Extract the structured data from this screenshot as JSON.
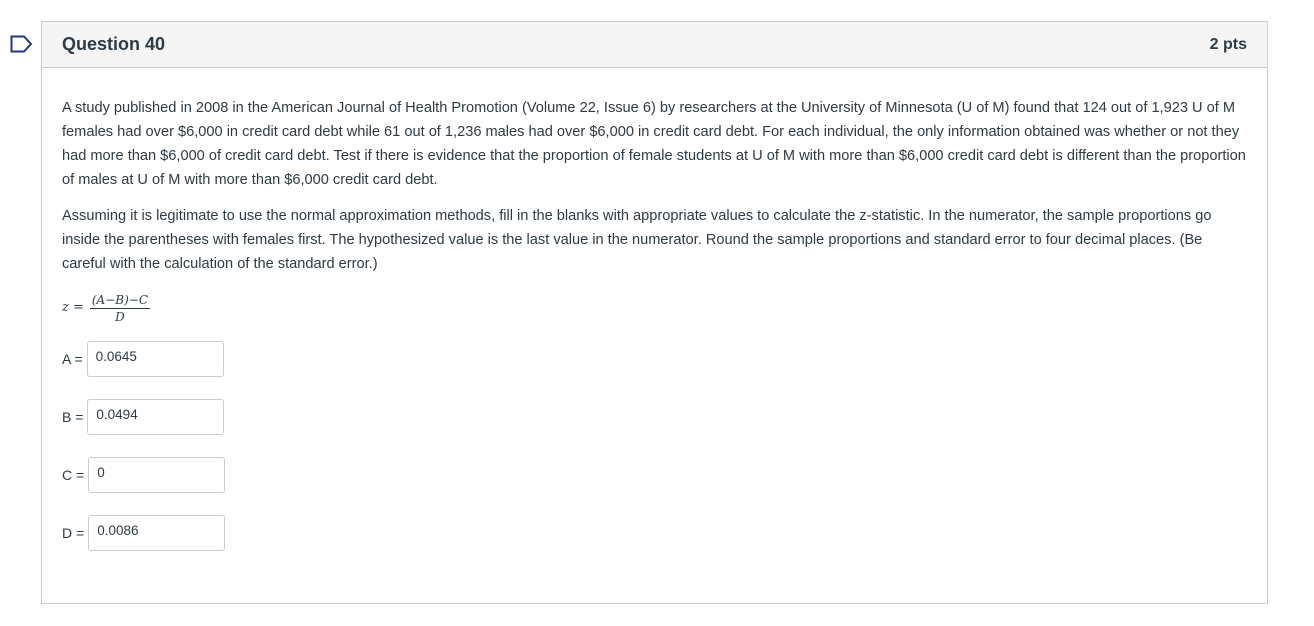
{
  "question": {
    "title": "Question 40",
    "points": "2 pts",
    "paragraph1": "A study published in 2008 in the American Journal of Health Promotion (Volume 22, Issue 6) by researchers at the University of Minnesota (U of M) found that 124 out of 1,923 U of M females had over $6,000 in credit card debt while 61 out of 1,236 males had over $6,000 in credit card debt. For each individual, the only information obtained was whether or not they had more than $6,000 of credit card debt. Test if there is evidence that the proportion of female students at U of M with more than $6,000 credit card debt is different than the proportion of males at U of M with more than $6,000 credit card debt.",
    "paragraph2": "Assuming it is legitimate to use the normal approximation methods, fill in the blanks with appropriate values to calculate the z-statistic. In the numerator, the sample proportions go inside the parentheses with females first. The hypothesized value is the last value in the numerator. Round the sample proportions and standard error to four decimal places. (Be careful with the calculation of the standard error.)"
  },
  "formula": {
    "lhs": "z =",
    "numerator": "(A−B)−C",
    "denominator": "D"
  },
  "answers": [
    {
      "label": "A =",
      "value": "0.0645"
    },
    {
      "label": "B =",
      "value": "0.0494"
    },
    {
      "label": "C =",
      "value": "0"
    },
    {
      "label": "D =",
      "value": "0.0086"
    }
  ],
  "icons": {
    "flag": "flag-outline-icon"
  },
  "colors": {
    "text": "#2d3b45",
    "border": "#c7cdd1",
    "header_bg": "#f5f5f5",
    "flag": "#2d3b45"
  }
}
